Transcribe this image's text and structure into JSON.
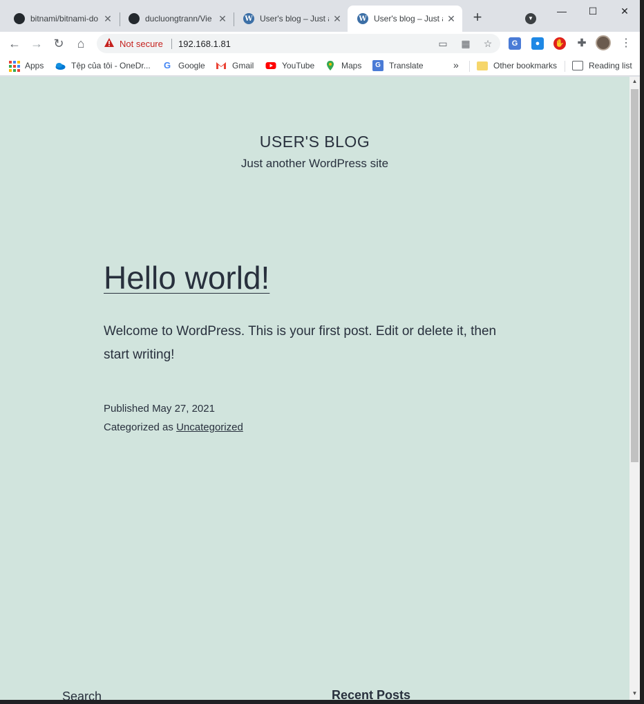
{
  "browser": {
    "tabs": [
      {
        "title": "bitnami/bitnami-do",
        "favicon": "github-icon",
        "active": false
      },
      {
        "title": "ducluongtrann/Vie",
        "favicon": "github-icon",
        "active": false
      },
      {
        "title": "User's blog – Just a",
        "favicon": "wordpress-icon",
        "active": false
      },
      {
        "title": "User's blog – Just a",
        "favicon": "wordpress-icon",
        "active": true
      }
    ],
    "security_label": "Not secure",
    "url": "192.168.1.81",
    "bookmarks": [
      {
        "label": "Apps",
        "icon": "apps-grid-icon"
      },
      {
        "label": "Tệp của tôi - OneDr...",
        "icon": "onedrive-icon"
      },
      {
        "label": "Google",
        "icon": "google-icon"
      },
      {
        "label": "Gmail",
        "icon": "gmail-icon"
      },
      {
        "label": "YouTube",
        "icon": "youtube-icon"
      },
      {
        "label": "Maps",
        "icon": "maps-icon"
      },
      {
        "label": "Translate",
        "icon": "translate-icon"
      }
    ],
    "other_bookmarks": "Other bookmarks",
    "reading_list": "Reading list",
    "overflow_glyph": "»"
  },
  "page": {
    "site_title": "USER'S BLOG",
    "site_description": "Just another WordPress site",
    "post_title": "Hello world!",
    "post_body": "Welcome to WordPress. This is your first post. Edit or delete it, then start writing!",
    "published_prefix": "Published",
    "published_date": "May 27, 2021",
    "category_prefix": "Categorized as",
    "category": "Uncategorized",
    "widgets": {
      "search": "Search",
      "recent_posts": "Recent Posts"
    },
    "background_color": "#d1e4dd",
    "text_color": "#28303d"
  }
}
